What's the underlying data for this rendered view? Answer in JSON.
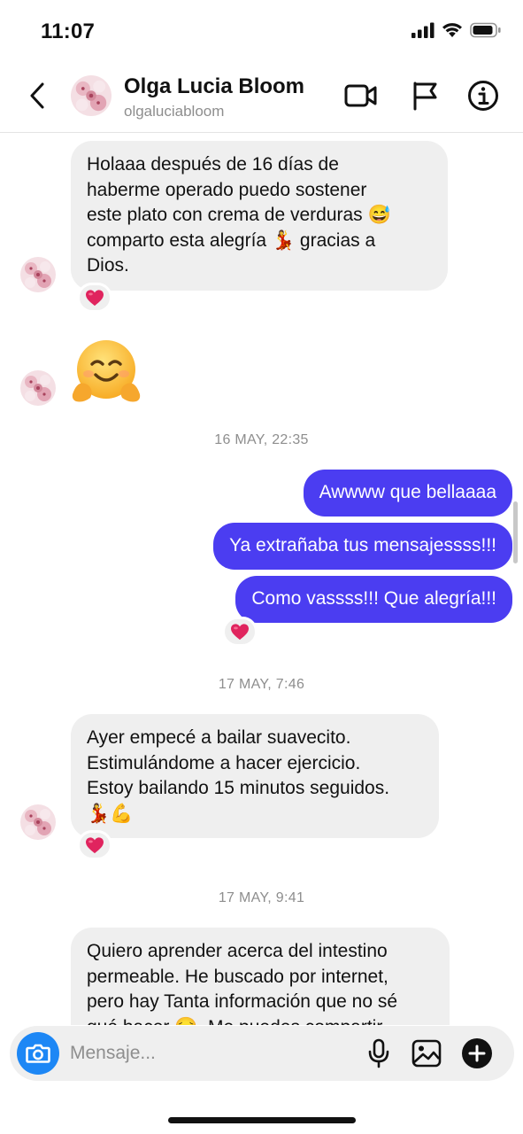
{
  "status": {
    "time": "11:07"
  },
  "header": {
    "name": "Olga Lucia Bloom",
    "handle": "olgaluciabloom",
    "back_icon": "chevron-left-icon",
    "video_icon": "video-camera-icon",
    "flag_icon": "flag-icon",
    "info_icon": "info-icon"
  },
  "messages": [
    {
      "from": "contact",
      "text": "Holaaa  después de 16 días de\nhaberme operado puedo sostener\neste plato con crema de verduras 😅\ncomparto esta alegría 💃 gracias a\nDios.",
      "reaction": "❤️"
    },
    {
      "from": "contact",
      "text": "🤗"
    },
    {
      "timestamp": "16 MAY, 22:35"
    },
    {
      "from": "me",
      "text": "Awwww que bellaaaa"
    },
    {
      "from": "me",
      "text": "Ya extrañaba tus mensajessss!!!"
    },
    {
      "from": "me",
      "text": "Como vassss!!! Que alegría!!!",
      "reaction": "❤️"
    },
    {
      "timestamp": "17 MAY, 7:46"
    },
    {
      "from": "contact",
      "text": "Ayer empecé a bailar suavecito.\nEstimulándome a hacer ejercicio.\nEstoy bailando 15 minutos seguidos.\n💃💪",
      "reaction": "❤️"
    },
    {
      "timestamp": "17 MAY, 9:41"
    },
    {
      "from": "contact",
      "text": "Quiero aprender acerca del intestino\npermeable. He buscado por internet,\npero hay Tanta información que no sé\nqué hacer 😔. Me puedes compartir"
    }
  ],
  "composer": {
    "placeholder": "Mensaje...",
    "camera_icon": "camera-icon",
    "mic_icon": "microphone-icon",
    "gallery_icon": "image-icon",
    "plus_icon": "plus-circle-icon"
  },
  "colors": {
    "outgoing_bubble": "#4b3df1",
    "incoming_bubble": "#efefef",
    "camera_button": "#1d87f5",
    "reaction_heart": "#e0245e"
  }
}
